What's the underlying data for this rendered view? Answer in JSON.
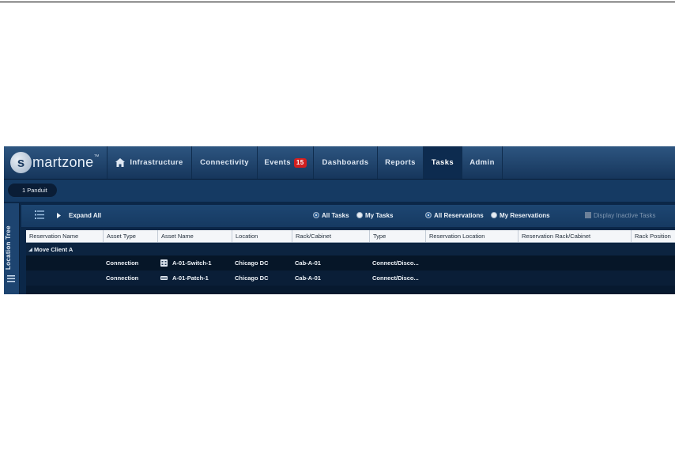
{
  "app": {
    "logo_mark": "s",
    "logo_text": "martzone",
    "logo_tm": "™"
  },
  "nav": {
    "tabs": [
      {
        "label": "Infrastructure",
        "icon": "home-icon"
      },
      {
        "label": "Connectivity"
      },
      {
        "label": "Events",
        "badge": "15"
      },
      {
        "label": "Dashboards"
      },
      {
        "label": "Reports"
      },
      {
        "label": "Tasks",
        "active": true
      },
      {
        "label": "Admin"
      }
    ]
  },
  "breadcrumb": {
    "label": "1 Panduit"
  },
  "left_panel": {
    "label": "Location Tree"
  },
  "toolbar": {
    "expand_all": "Expand All",
    "all_tasks": "All Tasks",
    "my_tasks": "My Tasks",
    "all_reservations": "All Reservations",
    "my_reservations": "My Reservations",
    "display_inactive": "Display Inactive Tasks"
  },
  "table": {
    "columns": [
      "Reservation Name",
      "Asset Type",
      "Asset Name",
      "Location",
      "Rack/Cabinet",
      "Type",
      "Reservation Location",
      "Reservation Rack/Cabinet",
      "Rack Position"
    ],
    "group": "Move Client A",
    "rows": [
      {
        "asset_type": "Connection",
        "asset_name": "A-01-Switch-1",
        "location": "Chicago DC",
        "rack": "Cab-A-01",
        "type": "Connect/Disco..."
      },
      {
        "asset_type": "Connection",
        "asset_name": "A-01-Patch-1",
        "location": "Chicago DC",
        "rack": "Cab-A-01",
        "type": "Connect/Disco..."
      }
    ]
  }
}
